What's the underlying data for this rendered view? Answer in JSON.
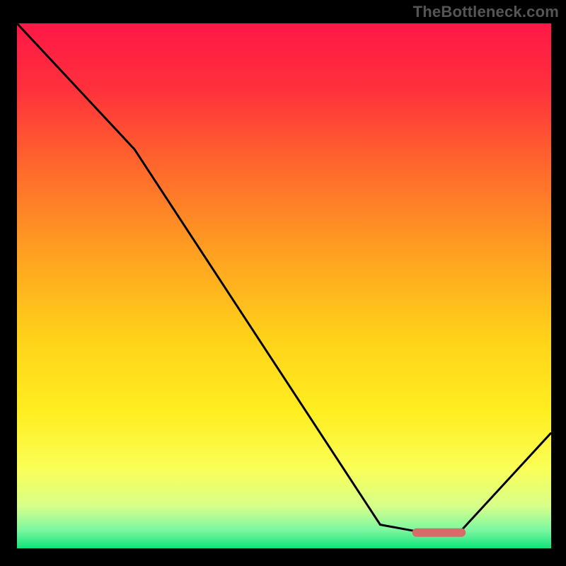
{
  "watermark": "TheBottleneck.com",
  "colors": {
    "gradient_stops": [
      {
        "offset": 0.0,
        "color": "#ff1846"
      },
      {
        "offset": 0.12,
        "color": "#ff2f3c"
      },
      {
        "offset": 0.28,
        "color": "#ff6a2c"
      },
      {
        "offset": 0.45,
        "color": "#ffa420"
      },
      {
        "offset": 0.6,
        "color": "#ffd21a"
      },
      {
        "offset": 0.74,
        "color": "#ffee20"
      },
      {
        "offset": 0.85,
        "color": "#faff58"
      },
      {
        "offset": 0.92,
        "color": "#d7ff8a"
      },
      {
        "offset": 0.965,
        "color": "#7cf7a0"
      },
      {
        "offset": 1.0,
        "color": "#10e47a"
      }
    ],
    "curve": "#000000",
    "marker_fill": "#d96a6a",
    "frame_bg": "#000000"
  },
  "chart_data": {
    "type": "line",
    "title": "",
    "xlabel": "",
    "ylabel": "",
    "xlim": [
      0,
      100
    ],
    "ylim": [
      0,
      100
    ],
    "series": [
      {
        "name": "bottleneck-curve",
        "x": [
          0,
          22,
          68,
          75,
          83,
          100
        ],
        "y": [
          100,
          76,
          4.5,
          3.2,
          3.2,
          22
        ]
      }
    ],
    "marker": {
      "name": "optimal-range",
      "x_start": 74,
      "x_end": 84,
      "y": 3.0,
      "thickness_pct": 1.6
    },
    "annotations": []
  }
}
